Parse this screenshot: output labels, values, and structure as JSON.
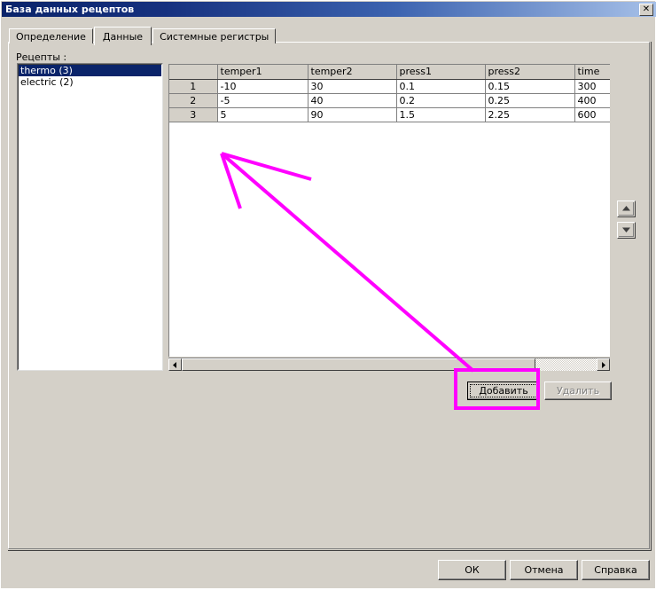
{
  "window": {
    "title": "База данных рецептов",
    "close_label": "✕",
    "accent_title_dark": "#0a246a",
    "accent_title_light": "#a6c0e8",
    "face_color": "#d4d0c8",
    "annotation_color": "#ff00ff"
  },
  "tabs": [
    {
      "label": "Определение",
      "active": false
    },
    {
      "label": "Данные",
      "active": true
    },
    {
      "label": "Системные регистры",
      "active": false
    }
  ],
  "recipes": {
    "label": "Рецепты :",
    "items": [
      {
        "label": "thermo (3)",
        "selected": true
      },
      {
        "label": "electric (2)",
        "selected": false
      }
    ]
  },
  "grid": {
    "corner_header": "",
    "columns": [
      "temper1",
      "temper2",
      "press1",
      "press2",
      "time"
    ],
    "rows": [
      {
        "num": "1",
        "cells": [
          "-10",
          "30",
          "0.1",
          "0.15",
          "300"
        ]
      },
      {
        "num": "2",
        "cells": [
          "-5",
          "40",
          "0.2",
          "0.25",
          "400"
        ]
      },
      {
        "num": "3",
        "cells": [
          "5",
          "90",
          "1.5",
          "2.25",
          "600"
        ]
      }
    ]
  },
  "scrollbar": {
    "left_arrow": "◄",
    "right_arrow": "►"
  },
  "spinners": {
    "up_arrow": "▲",
    "down_arrow": "▼"
  },
  "record_buttons": {
    "add_label": "Добавить",
    "delete_label": "Удалить",
    "delete_disabled": true,
    "add_focused": true
  },
  "dialog_buttons": {
    "ok_label": "ОК",
    "cancel_label": "Отмена",
    "help_label": "Справка"
  }
}
